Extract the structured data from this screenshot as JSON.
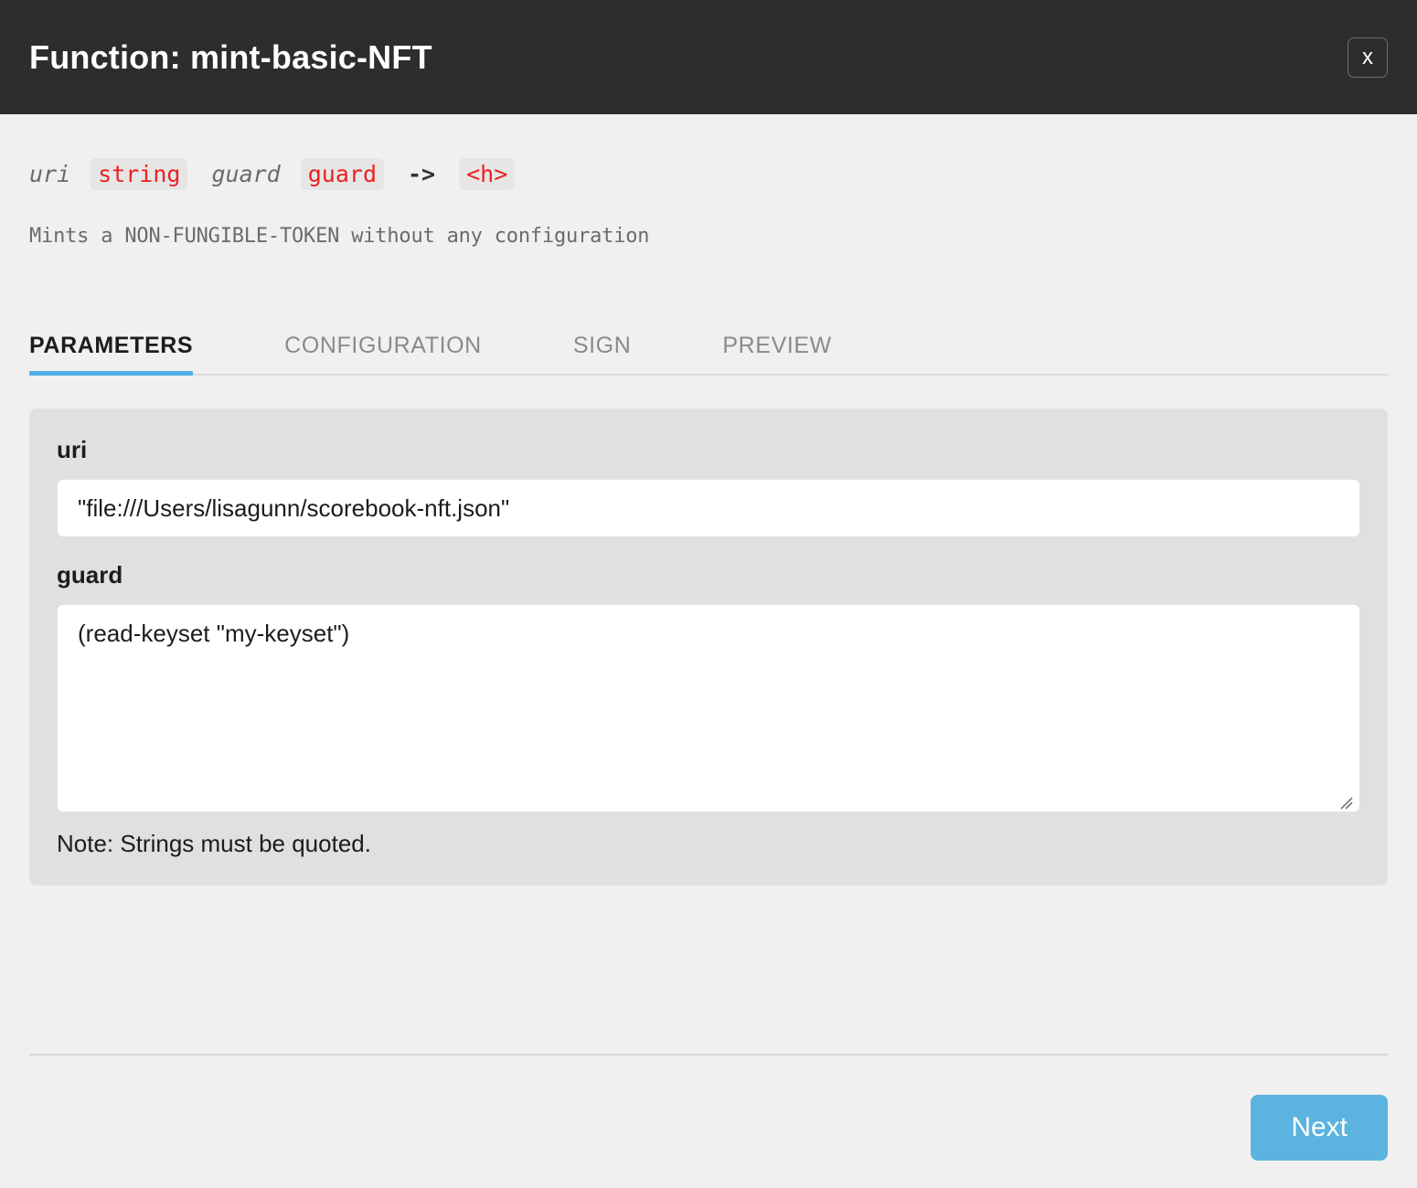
{
  "header": {
    "title": "Function: mint-basic-NFT",
    "close_label": "x"
  },
  "signature": {
    "arg1_name": "uri",
    "arg1_type": "string",
    "arg2_name": "guard",
    "arg2_type": "guard",
    "arrow": "->",
    "return_type": "<h>"
  },
  "description": "Mints a NON-FUNGIBLE-TOKEN without any configuration",
  "tabs": [
    {
      "label": "PARAMETERS",
      "active": true
    },
    {
      "label": "CONFIGURATION",
      "active": false
    },
    {
      "label": "SIGN",
      "active": false
    },
    {
      "label": "PREVIEW",
      "active": false
    }
  ],
  "parameters": {
    "uri": {
      "label": "uri",
      "value": "\"file:///Users/lisagunn/scorebook-nft.json\"",
      "placeholder": ""
    },
    "guard": {
      "label": "guard",
      "value": "(read-keyset \"my-keyset\")",
      "placeholder": ""
    },
    "note": "Note: Strings must be quoted."
  },
  "footer": {
    "next_label": "Next"
  },
  "colors": {
    "header_bg": "#2d2d2d",
    "page_bg": "#f0f0f0",
    "panel_bg": "#e0e0e0",
    "accent_blue": "#4fb0e3",
    "button_blue": "#5bb3e0",
    "type_red": "#ee1f1f"
  }
}
